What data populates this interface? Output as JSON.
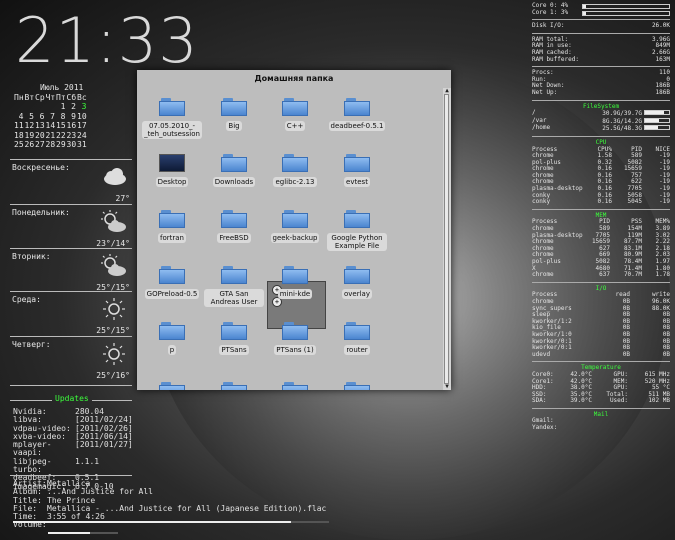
{
  "clock": "21:33",
  "calendar": {
    "title": "Июль 2011",
    "weekdays": [
      "Пн",
      "Вт",
      "Ср",
      "Чт",
      "Пт",
      "Сб",
      "Вс"
    ],
    "rows": [
      [
        "",
        "",
        "",
        "",
        "1",
        "2",
        "3"
      ],
      [
        "4",
        "5",
        "6",
        "7",
        "8",
        "9",
        "10"
      ],
      [
        "11",
        "12",
        "13",
        "14",
        "15",
        "16",
        "17"
      ],
      [
        "18",
        "19",
        "20",
        "21",
        "22",
        "23",
        "24"
      ],
      [
        "25",
        "26",
        "27",
        "28",
        "29",
        "30",
        "31"
      ]
    ],
    "today": "3"
  },
  "weather": [
    {
      "day": "Воскресенье:",
      "temp": "27°",
      "icon": "cloud-icon"
    },
    {
      "day": "Понедельник:",
      "temp": "23°/14°",
      "icon": "sun-cloud-icon"
    },
    {
      "day": "Вторник:",
      "temp": "25°/15°",
      "icon": "sun-cloud-icon"
    },
    {
      "day": "Среда:",
      "temp": "25°/15°",
      "icon": "sun-icon"
    },
    {
      "day": "Четверг:",
      "temp": "25°/16°",
      "icon": "sun-icon"
    }
  ],
  "updates": {
    "title": "Updates",
    "items": [
      {
        "k": "Nvidia:",
        "v": "280.04"
      },
      {
        "k": "libva:",
        "v": "[2011/02/24]"
      },
      {
        "k": "vdpau-video:",
        "v": "[2011/02/26]"
      },
      {
        "k": "xvba-video:",
        "v": "[2011/06/14]"
      },
      {
        "k": "mplayer-vaapi:",
        "v": "[2011/01/27]"
      },
      {
        "k": "libjpeg-turbo:",
        "v": "1.1.1"
      },
      {
        "k": "deadbeef:",
        "v": "0.5.1"
      },
      {
        "k": "imagemagic:",
        "v": "6.7.0-10"
      }
    ]
  },
  "player": {
    "items": [
      {
        "k": "Artist:",
        "v": "Metallica"
      },
      {
        "k": "Album:",
        "v": "...And Justice for All"
      },
      {
        "k": "Title:",
        "v": "The Prince"
      },
      {
        "k": "File:",
        "v": "Metallica - ...And Justice for All (Japanese Edition).flac"
      },
      {
        "k": "Time:",
        "v": "3:55 of 4:26"
      },
      {
        "k": "Volume:",
        "v": ""
      }
    ],
    "progress": 0.88,
    "volume": 0.6
  },
  "window": {
    "title": "Домашняя папка",
    "items": [
      {
        "label": "07.05.2010_-_teh_outsession",
        "type": "folder"
      },
      {
        "label": "Big",
        "type": "folder"
      },
      {
        "label": "C++",
        "type": "folder"
      },
      {
        "label": "deadbeef-0.5.1",
        "type": "folder"
      },
      {
        "label": "Desktop",
        "type": "desktop"
      },
      {
        "label": "Downloads",
        "type": "folder"
      },
      {
        "label": "eglibc-2.13",
        "type": "folder"
      },
      {
        "label": "evtest",
        "type": "folder"
      },
      {
        "label": "fortran",
        "type": "folder"
      },
      {
        "label": "FreeBSD",
        "type": "folder"
      },
      {
        "label": "geek-backup",
        "type": "folder"
      },
      {
        "label": "Google Python Example File",
        "type": "folder"
      },
      {
        "label": "GOPreload-0.5",
        "type": "folder"
      },
      {
        "label": "GTA San Andreas User",
        "type": "folder"
      },
      {
        "label": "mini-kde",
        "type": "folder"
      },
      {
        "label": "overlay",
        "type": "folder"
      },
      {
        "label": "p",
        "type": "folder"
      },
      {
        "label": "PTSans",
        "type": "folder"
      },
      {
        "label": "PTSans (1)",
        "type": "folder"
      },
      {
        "label": "router",
        "type": "folder"
      }
    ]
  },
  "system": {
    "cores": [
      {
        "k": "Core 0:",
        "v": "4%",
        "p": 0.04
      },
      {
        "k": "Core 1:",
        "v": "3%",
        "p": 0.03
      }
    ],
    "disk": {
      "k": "Disk I/O:",
      "v": "26.0K"
    },
    "ram": [
      {
        "k": "RAM total:",
        "v": "3.96G"
      },
      {
        "k": "RAM in use:",
        "v": "849M"
      },
      {
        "k": "RAM cached:",
        "v": "2.66G"
      },
      {
        "k": "RAM buffered:",
        "v": "163M"
      }
    ],
    "procs": [
      {
        "k": "Procs:",
        "v": "110"
      },
      {
        "k": "Run:",
        "v": "0"
      },
      {
        "k": "Net Down:",
        "v": "186B"
      },
      {
        "k": "Net Up:",
        "v": "186B"
      }
    ],
    "fs_title": "FileSystem",
    "fs": [
      {
        "k": "/",
        "v": "30.9G/39.7G",
        "p": 0.78
      },
      {
        "k": "/var",
        "v": "8G.3G/14.2G",
        "p": 0.58
      },
      {
        "k": "/home",
        "v": "25.5G/48.3G",
        "p": 0.53
      }
    ],
    "cpu_title": "CPU",
    "cpu_head": [
      "Process",
      "CPU%",
      "PID",
      "NICE"
    ],
    "cpu_rows": [
      [
        "chrome",
        "1.58",
        "589",
        "-19"
      ],
      [
        "pol-plus",
        "0.32",
        "5082",
        "-19"
      ],
      [
        "chrome",
        "0.16",
        "15659",
        "-19"
      ],
      [
        "chrome",
        "0.16",
        "757",
        "-19"
      ],
      [
        "chrome",
        "0.16",
        "622",
        "-19"
      ],
      [
        "plasma-desktop",
        "0.16",
        "7705",
        "-19"
      ],
      [
        "conky",
        "0.16",
        "5058",
        "-19"
      ],
      [
        "conky",
        "0.16",
        "5045",
        "-19"
      ]
    ],
    "mem_title": "MEM",
    "mem_head": [
      "Process",
      "PID",
      "PSS",
      "MEM%"
    ],
    "mem_rows": [
      [
        "chrome",
        "589",
        "154M",
        "3.89"
      ],
      [
        "plasma-desktop",
        "7705",
        "119M",
        "3.02"
      ],
      [
        "chrome",
        "15659",
        "87.7M",
        "2.22"
      ],
      [
        "chrome",
        "627",
        "83.1M",
        "2.18"
      ],
      [
        "chrome",
        "669",
        "80.9M",
        "2.03"
      ],
      [
        "pol-plus",
        "5082",
        "78.4M",
        "1.97"
      ],
      [
        "X",
        "4680",
        "71.4M",
        "1.80"
      ],
      [
        "chrome",
        "637",
        "70.7M",
        "1.78"
      ]
    ],
    "io_title": "I/O",
    "io_head": [
      "Process",
      "read",
      "write"
    ],
    "io_rows": [
      [
        "chrome",
        "0B",
        "96.0K"
      ],
      [
        "sync_supers",
        "0B",
        "88.0K"
      ],
      [
        "sleep",
        "0B",
        "0B"
      ],
      [
        "kworker/1:2",
        "0B",
        "0B"
      ],
      [
        "kio_file",
        "0B",
        "0B"
      ],
      [
        "kworker/1:0",
        "0B",
        "0B"
      ],
      [
        "kworker/0:1",
        "0B",
        "0B"
      ],
      [
        "kworker/0:1",
        "0B",
        "0B"
      ],
      [
        "udevd",
        "0B",
        "0B"
      ]
    ],
    "temp_title": "Temperature",
    "temp_rows": [
      [
        "Core0:",
        "42.0°C",
        "GPU:",
        "615 MHz"
      ],
      [
        "Core1:",
        "42.0°C",
        "MEM:",
        "520 MHz"
      ],
      [
        "HDD:",
        "38.0°C",
        "GPU:",
        "55 °C"
      ],
      [
        "SSD:",
        "35.0°C",
        "Total:",
        "511 MB"
      ],
      [
        "SDA:",
        "39.0°C",
        "Used:",
        "102 MB"
      ]
    ],
    "mail_title": "Mail",
    "mail": [
      {
        "k": "Gmail:",
        "v": ""
      },
      {
        "k": "Yandex:",
        "v": ""
      }
    ]
  }
}
